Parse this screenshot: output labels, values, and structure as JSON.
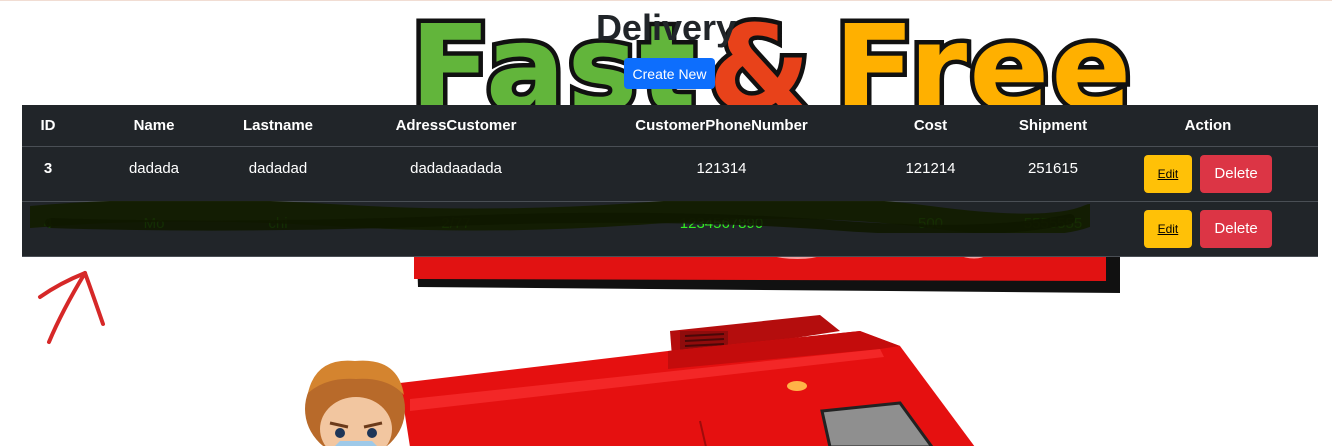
{
  "header": {
    "title": "Delivery",
    "create_label": "Create New"
  },
  "banner": {
    "word1": "Fast",
    "word2": "&",
    "word3": "Free"
  },
  "table": {
    "columns": [
      "ID",
      "Name",
      "Lastname",
      "AdressCustomer",
      "CustomerPhoneNumber",
      "Cost",
      "Shipment",
      "Action"
    ],
    "rows": [
      {
        "id": "3",
        "name": "dadada",
        "lastname": "dadadad",
        "address": "dadadaadada",
        "phone": "121314",
        "cost": "121214",
        "shipment": "251615",
        "edit_label": "Edit",
        "delete_label": "Delete"
      },
      {
        "id": "4",
        "name": "Mo",
        "lastname": "chi",
        "address": "2/77",
        "phone": "1234567890",
        "cost": "500",
        "shipment": "5555555",
        "edit_label": "Edit",
        "delete_label": "Delete"
      }
    ]
  },
  "colors": {
    "table_bg": "#212529",
    "primary": "#0d6efd",
    "warning": "#ffc107",
    "danger": "#dc3545",
    "highlight_text": "#33ee22",
    "annotation_arrow": "#d62828"
  }
}
